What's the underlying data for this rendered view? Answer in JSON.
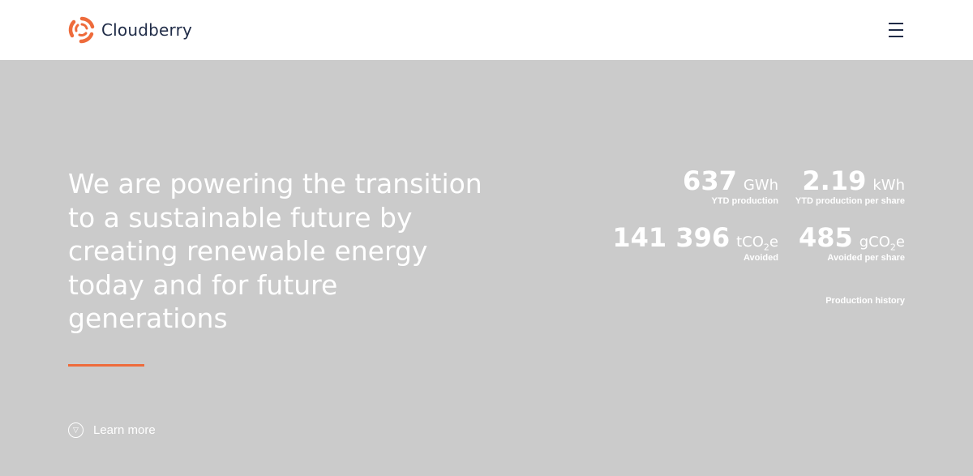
{
  "header": {
    "brand": "Cloudberry",
    "menu_icon": "hamburger-icon"
  },
  "hero": {
    "headline": "We are powering the transition to a sustainable future by creating renewable energy today and for future generations",
    "learn_more": "Learn more",
    "learn_more_icon": "circle-down-icon"
  },
  "stats": [
    {
      "value": "637",
      "unit_main": "GWh",
      "unit_sub": "",
      "unit_tail": "",
      "label": "YTD production"
    },
    {
      "value": "2.19",
      "unit_main": "kWh",
      "unit_sub": "",
      "unit_tail": "",
      "label": "YTD production per share"
    },
    {
      "value": "141 396",
      "unit_main": "tCO",
      "unit_sub": "2",
      "unit_tail": "e",
      "label": "Avoided"
    },
    {
      "value": "485",
      "unit_main": "gCO",
      "unit_sub": "2",
      "unit_tail": "e",
      "label": "Avoided per share"
    }
  ],
  "production_history_link": "Production history",
  "colors": {
    "accent": "#ee6b3b",
    "hero_bg": "#cbcbcb",
    "brand_text": "#1f2b47"
  }
}
